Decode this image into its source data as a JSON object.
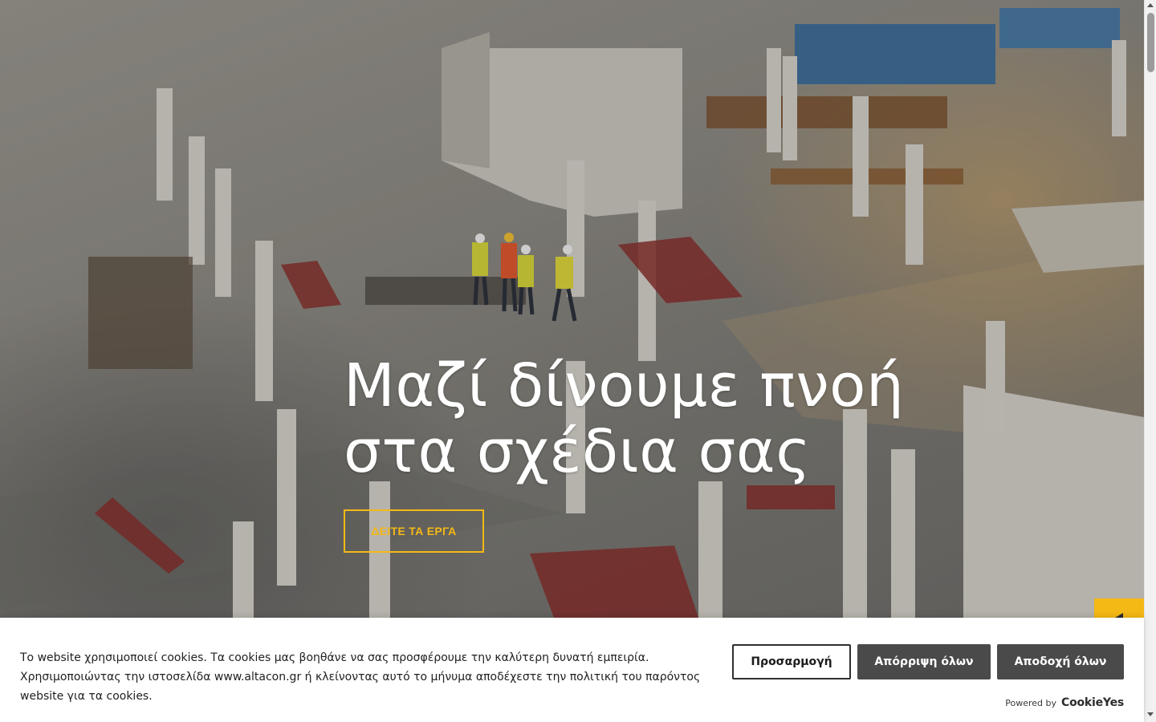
{
  "hero": {
    "headline_line1": "Μαζί δίνουμε πνοή",
    "headline_line2": "στα σχέδια σας",
    "cta_label": "ΔΕΙΤΕ ΤΑ ΕΡΓΑ",
    "accent_color": "#f5b915"
  },
  "cookie_banner": {
    "text": "Το website χρησιμοποιεί cookies. Τα cookies μας βοηθάνε να σας προσφέρουμε την καλύτερη δυνατή εμπειρία. Χρησιμοποιώντας την ιστοσελίδα www.altacon.gr ή κλείνοντας αυτό το μήνυμα αποδέχεστε την πολιτική του παρόντος website για τα cookies.",
    "customize_label": "Προσαρμογή",
    "reject_label": "Απόρριψη όλων",
    "accept_label": "Αποδοχή όλων",
    "powered_by": "Powered by",
    "brand": "CookieYes"
  }
}
